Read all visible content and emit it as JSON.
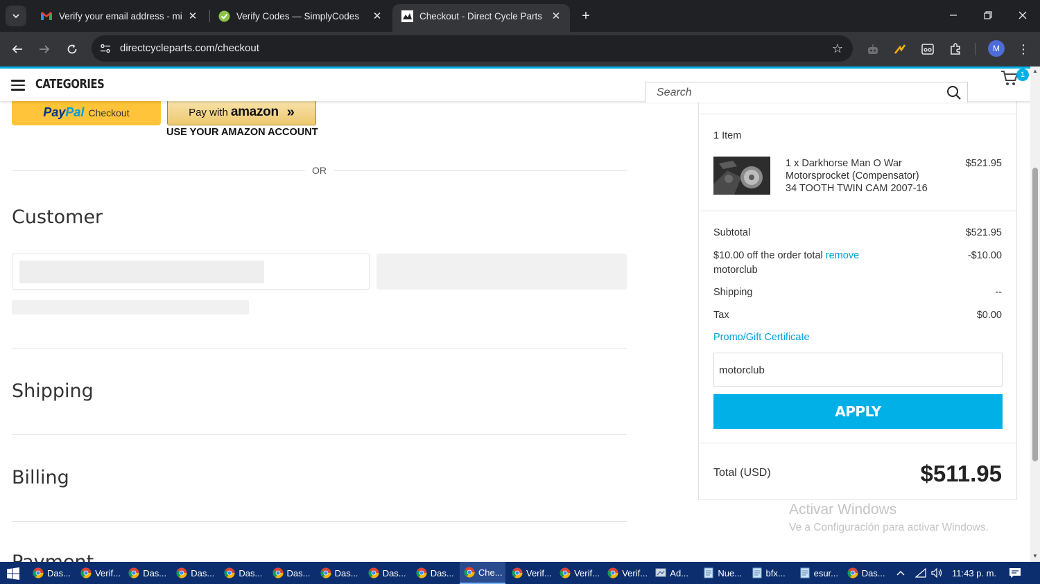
{
  "browser": {
    "tabs": [
      {
        "title": "Verify your email address - mile",
        "favicon": "gmail-icon",
        "active": false
      },
      {
        "title": "Verify Codes — SimplyCodes",
        "favicon": "simplycodes-icon",
        "active": false
      },
      {
        "title": "Checkout - Direct Cycle Parts",
        "favicon": "site-icon",
        "active": true
      }
    ],
    "url": "directcycleparts.com/checkout",
    "profile_initial": "M"
  },
  "header": {
    "categories_label": "CATEGORIES",
    "search_placeholder": "Search",
    "cart_count": "1"
  },
  "checkout": {
    "paypal": {
      "brand_pay": "Pay",
      "brand_pal": "Pal",
      "label": "Checkout"
    },
    "amazon": {
      "prefix": "Pay with",
      "brand": "amazon",
      "chevrons": "»",
      "subtext": "USE YOUR AMAZON ACCOUNT"
    },
    "or_text": "OR",
    "sections": {
      "customer": "Customer",
      "shipping": "Shipping",
      "billing": "Billing",
      "payment": "Payment"
    }
  },
  "summary": {
    "item_count": "1 Item",
    "item": {
      "line1": "1 x Darkhorse Man O War",
      "line2": "Motorsprocket (Compensator)",
      "line3": "34 TOOTH TWIN CAM 2007-16",
      "price": "$521.95"
    },
    "subtotal_label": "Subtotal",
    "subtotal_value": "$521.95",
    "discount_label": "$10.00 off the order total",
    "discount_remove": "remove",
    "discount_code": "motorclub",
    "discount_value": "-$10.00",
    "shipping_label": "Shipping",
    "shipping_value": "--",
    "tax_label": "Tax",
    "tax_value": "$0.00",
    "promo_link": "Promo/Gift Certificate",
    "promo_input_value": "motorclub",
    "apply_label": "APPLY",
    "total_label": "Total (USD)",
    "total_value": "$511.95"
  },
  "watermark": {
    "line1": "Activar Windows",
    "line2": "Ve a Configuración para activar Windows."
  },
  "taskbar": {
    "items": [
      {
        "label": "Das...",
        "icon": "chrome-icon"
      },
      {
        "label": "Verif...",
        "icon": "chrome-icon"
      },
      {
        "label": "Das...",
        "icon": "chrome-icon"
      },
      {
        "label": "Das...",
        "icon": "chrome-icon"
      },
      {
        "label": "Das...",
        "icon": "chrome-icon"
      },
      {
        "label": "Das...",
        "icon": "chrome-icon"
      },
      {
        "label": "Das...",
        "icon": "chrome-icon"
      },
      {
        "label": "Das...",
        "icon": "chrome-icon"
      },
      {
        "label": "Das...",
        "icon": "chrome-icon"
      },
      {
        "label": "Che...",
        "icon": "chrome-icon",
        "active": true
      },
      {
        "label": "Verif...",
        "icon": "chrome-icon"
      },
      {
        "label": "Verif...",
        "icon": "chrome-icon"
      },
      {
        "label": "Verif...",
        "icon": "chrome-icon"
      },
      {
        "label": "Ad...",
        "icon": "app-icon"
      },
      {
        "label": "Nue...",
        "icon": "notepad-icon"
      },
      {
        "label": "bfx...",
        "icon": "notepad-icon"
      },
      {
        "label": "esur...",
        "icon": "notepad-icon"
      },
      {
        "label": "Das...",
        "icon": "chrome-icon"
      }
    ],
    "clock": "11:43 p. m."
  },
  "colors": {
    "accent": "#00b0e6",
    "paypal_yellow": "#ffc439",
    "link": "#00a0d9",
    "taskbar": "#0c2e6e"
  }
}
